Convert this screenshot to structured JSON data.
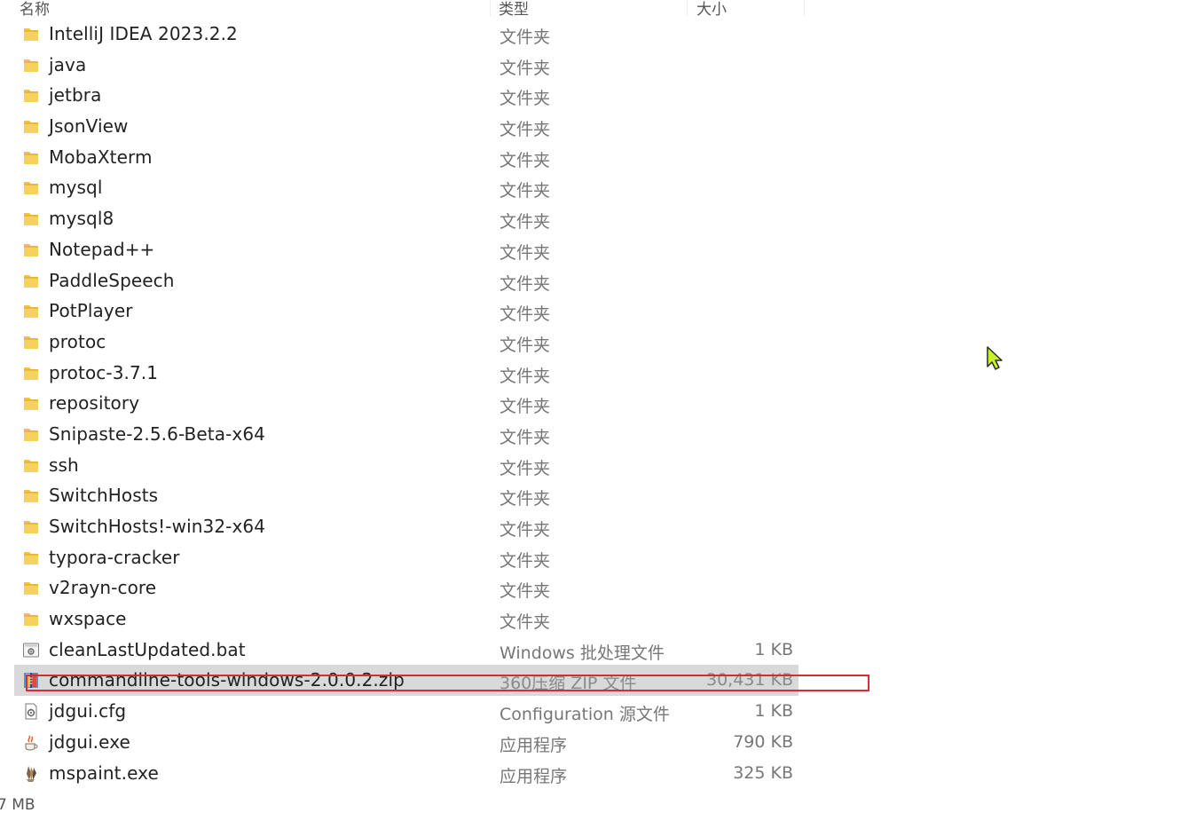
{
  "header": {
    "name_label": "名称",
    "type_label": "类型",
    "size_label": "大小"
  },
  "files": [
    {
      "name": "IntelliJ IDEA 2023.2.2",
      "type": "文件夹",
      "size": "",
      "icon": "folder-icon"
    },
    {
      "name": "java",
      "type": "文件夹",
      "size": "",
      "icon": "folder-icon"
    },
    {
      "name": "jetbra",
      "type": "文件夹",
      "size": "",
      "icon": "folder-icon"
    },
    {
      "name": "JsonView",
      "type": "文件夹",
      "size": "",
      "icon": "folder-icon"
    },
    {
      "name": "MobaXterm",
      "type": "文件夹",
      "size": "",
      "icon": "folder-icon"
    },
    {
      "name": "mysql",
      "type": "文件夹",
      "size": "",
      "icon": "folder-icon"
    },
    {
      "name": "mysql8",
      "type": "文件夹",
      "size": "",
      "icon": "folder-icon"
    },
    {
      "name": "Notepad++",
      "type": "文件夹",
      "size": "",
      "icon": "folder-icon"
    },
    {
      "name": "PaddleSpeech",
      "type": "文件夹",
      "size": "",
      "icon": "folder-icon"
    },
    {
      "name": "PotPlayer",
      "type": "文件夹",
      "size": "",
      "icon": "folder-icon"
    },
    {
      "name": "protoc",
      "type": "文件夹",
      "size": "",
      "icon": "folder-icon"
    },
    {
      "name": "protoc-3.7.1",
      "type": "文件夹",
      "size": "",
      "icon": "folder-icon"
    },
    {
      "name": "repository",
      "type": "文件夹",
      "size": "",
      "icon": "folder-icon"
    },
    {
      "name": "Snipaste-2.5.6-Beta-x64",
      "type": "文件夹",
      "size": "",
      "icon": "folder-icon"
    },
    {
      "name": "ssh",
      "type": "文件夹",
      "size": "",
      "icon": "folder-icon"
    },
    {
      "name": "SwitchHosts",
      "type": "文件夹",
      "size": "",
      "icon": "folder-icon"
    },
    {
      "name": "SwitchHosts!-win32-x64",
      "type": "文件夹",
      "size": "",
      "icon": "folder-icon"
    },
    {
      "name": "typora-cracker",
      "type": "文件夹",
      "size": "",
      "icon": "folder-icon"
    },
    {
      "name": "v2rayn-core",
      "type": "文件夹",
      "size": "",
      "icon": "folder-icon"
    },
    {
      "name": "wxspace",
      "type": "文件夹",
      "size": "",
      "icon": "folder-icon"
    },
    {
      "name": "cleanLastUpdated.bat",
      "type": "Windows 批处理文件",
      "size": "1 KB",
      "icon": "batch-file-icon"
    },
    {
      "name": "commandline-tools-windows-2.0.0.2.zip",
      "type": "360压缩 ZIP 文件",
      "size": "30,431 KB",
      "icon": "zip-archive-icon",
      "selected": true
    },
    {
      "name": "jdgui.cfg",
      "type": "Configuration 源文件",
      "size": "1 KB",
      "icon": "config-file-icon"
    },
    {
      "name": "jdgui.exe",
      "type": "应用程序",
      "size": "790 KB",
      "icon": "java-app-icon"
    },
    {
      "name": "mspaint.exe",
      "type": "应用程序",
      "size": "325 KB",
      "icon": "paint-app-icon"
    }
  ],
  "status_bar": {
    "selection_size": "7 MB"
  },
  "colors": {
    "folder": "#f5c242",
    "selected_row": "#d9d9d9",
    "highlight_border": "#d92b35",
    "cursor_fill": "#c7f22a"
  }
}
